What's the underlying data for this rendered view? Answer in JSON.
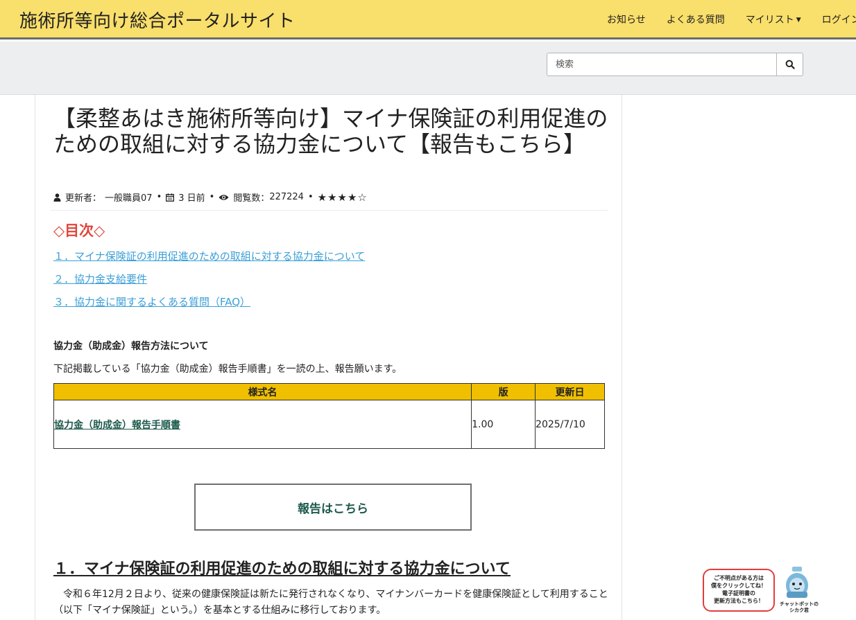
{
  "header": {
    "site_title": "施術所等向け総合ポータルサイト",
    "nav": [
      "お知らせ",
      "よくある質問",
      "マイリスト",
      "ログイン"
    ]
  },
  "search": {
    "placeholder": "検索"
  },
  "article": {
    "title": "【柔整あはき施術所等向け】マイナ保険証の利用促進のための取組に対する協力金について【報告もこちら】",
    "meta": {
      "author_label": "更新者：",
      "author": "一般職員07",
      "date": "3 日前",
      "views_label": "閲覧数：",
      "views": "227224",
      "rating_text": "★★★★☆",
      "rating": 4
    },
    "toc_title": "◇目次◇",
    "toc": [
      "１．マイナ保険証の利用促進のための取組に対する協力金について",
      "２．協力金支給要件",
      "３．協力金に関するよくある質問（FAQ）"
    ],
    "report_heading": "協力金（助成金）報告方法について",
    "report_text": "下記掲載している「協力金（助成金）報告手順書」を一読の上、報告願います。",
    "table": {
      "headers": [
        "様式名",
        "版",
        "更新日"
      ],
      "rows": [
        {
          "name": "協力金（助成金）報告手順書",
          "version": "1.00",
          "date": "2025/7/10"
        }
      ]
    },
    "report_button": "報告はこちら",
    "section1_heading": "１．マイナ保険証の利用促進のための取組に対する協力金について",
    "section1_text": "　令和６年12月２日より、従来の健康保険証は新たに発行されなくなり、マイナンバーカードを健康保険証として利用すること（以下「マイナ保険証」という。）を基本とする仕組みに移行しております。"
  },
  "chatbot": {
    "bubble_lines": [
      "ご不明点がある方は",
      "僕をクリックしてね！",
      "電子証明書の",
      "更新方法もこちら！"
    ],
    "caption_lines": [
      "チャットボットの",
      "シカク君"
    ]
  },
  "colors": {
    "header_bg": "#f9df6b",
    "table_header_bg": "#f0c000",
    "toc_title": "#e0453a",
    "link": "#3a9fd8",
    "accent_green": "#1d5a4c"
  }
}
